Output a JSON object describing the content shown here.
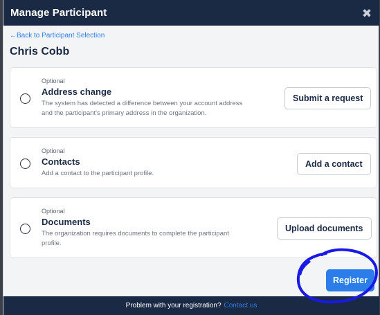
{
  "modal": {
    "title": "Manage Participant",
    "close_icon": "close-icon"
  },
  "nav": {
    "back_label": "←Back to Participant Selection"
  },
  "participant": {
    "name": "Chris Cobb"
  },
  "options": [
    {
      "tag": "Optional",
      "title": "Address change",
      "description_line1": "The system has detected a difference between your account address",
      "description_line2": "and the participant's primary address in the organization.",
      "button_label": "Submit a request",
      "selected": false
    },
    {
      "tag": "Optional",
      "title": "Contacts",
      "description_line1": "Add a contact to the participant profile.",
      "description_line2": "",
      "button_label": "Add a contact",
      "selected": false
    },
    {
      "tag": "Optional",
      "title": "Documents",
      "description_line1": "The organization requires documents to complete the participant",
      "description_line2": "profile.",
      "button_label": "Upload documents",
      "selected": false
    }
  ],
  "actions": {
    "register_label": "Register"
  },
  "footer": {
    "text": "Problem with your registration?",
    "link_label": "Contact us"
  },
  "colors": {
    "header_bg": "#1b2a44",
    "accent": "#2b7de9",
    "annotation": "#1a1ae6"
  }
}
